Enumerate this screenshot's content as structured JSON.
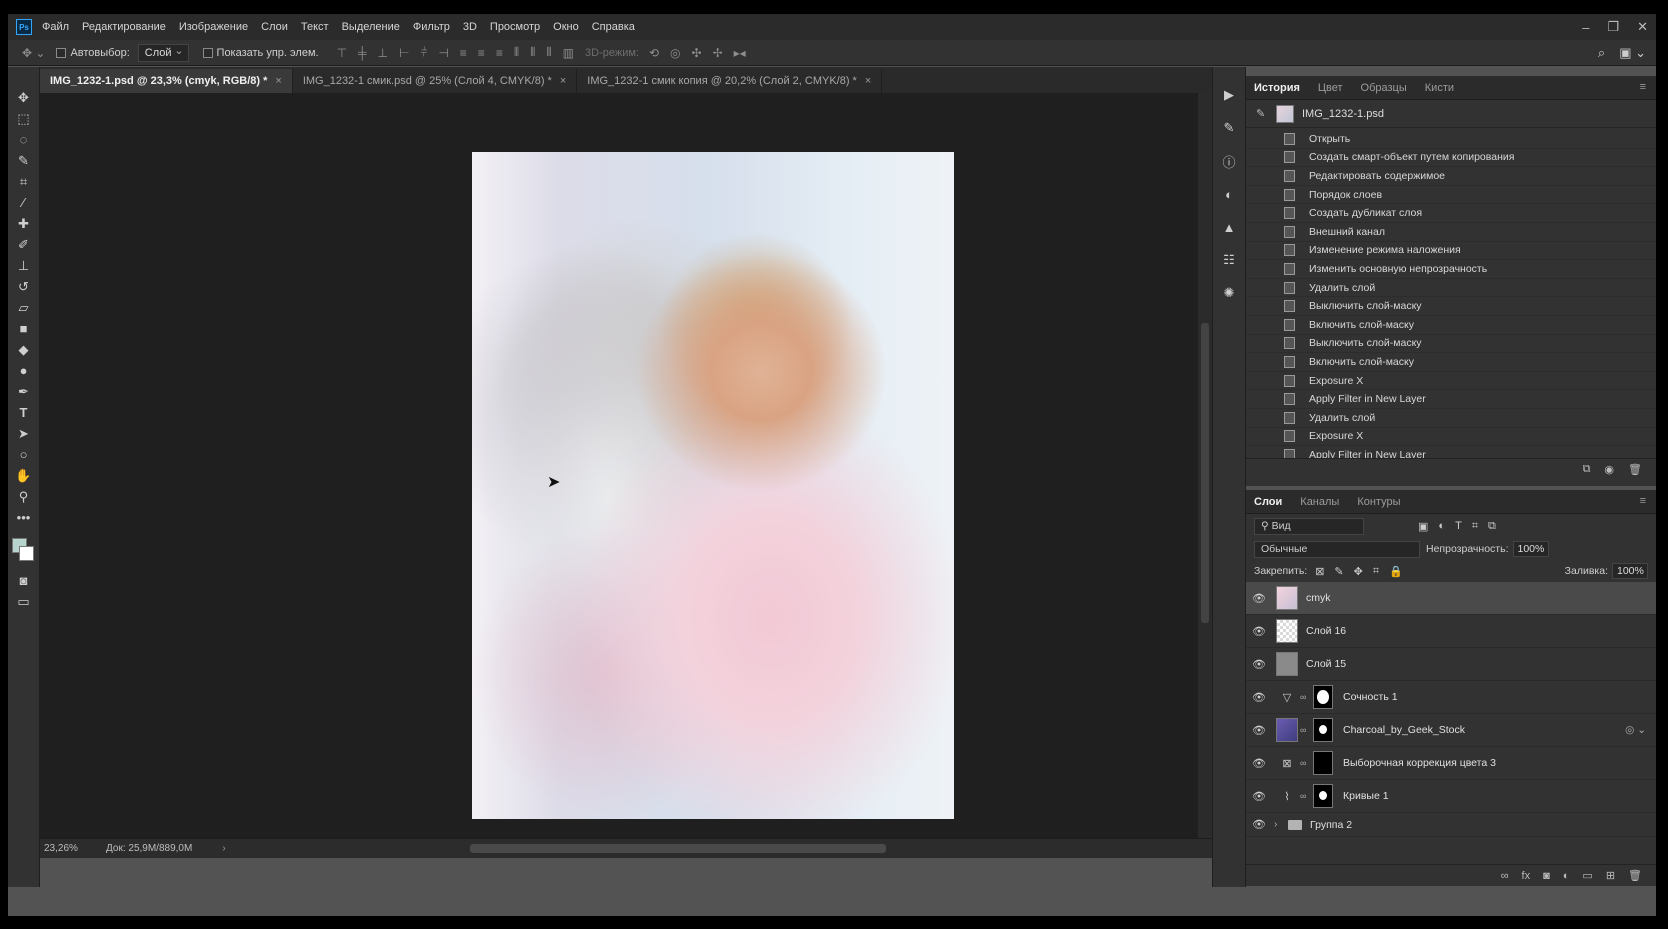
{
  "menu": [
    "Файл",
    "Редактирование",
    "Изображение",
    "Слои",
    "Текст",
    "Выделение",
    "Фильтр",
    "3D",
    "Просмотр",
    "Окно",
    "Справка"
  ],
  "options_bar": {
    "autoselect_label": "Автовыбор:",
    "autoselect_value": "Слой",
    "show_transform_label": "Показать упр. элем.",
    "mode3d_label": "3D-режим:"
  },
  "doc_tabs": [
    {
      "label": "IMG_1232-1.psd @ 23,3% (cmyk, RGB/8) *",
      "active": true
    },
    {
      "label": "IMG_1232-1 смик.psd @ 25% (Слой 4, CMYK/8) *",
      "active": false
    },
    {
      "label": "IMG_1232-1 смик копия @ 20,2% (Слой 2, CMYK/8) *",
      "active": false
    }
  ],
  "status": {
    "zoom": "23,26%",
    "doc": "Док: 25,9M/889,0M"
  },
  "history_panel": {
    "tabs": [
      "История",
      "Цвет",
      "Образцы",
      "Кисти"
    ],
    "snapshot": "IMG_1232-1.psd",
    "items": [
      "Открыть",
      "Создать смарт-объект путем копирования",
      "Редактировать содержимое",
      "Порядок слоев",
      "Создать дубликат слоя",
      "Внешний канал",
      "Изменение режима наложения",
      "Изменить основную непрозрачность",
      "Удалить слой",
      "Выключить слой-маску",
      "Включить слой-маску",
      "Выключить слой-маску",
      "Включить слой-маску",
      "Exposure X",
      "Apply Filter in New Layer",
      "Удалить слой",
      "Exposure X",
      "Apply Filter in New Layer"
    ]
  },
  "layers_panel": {
    "tabs": [
      "Слои",
      "Каналы",
      "Контуры"
    ],
    "filter_value": "Вид",
    "blend_mode": "Обычные",
    "opacity_label": "Непрозрачность:",
    "opacity_value": "100%",
    "lock_label": "Закрепить:",
    "fill_label": "Заливка:",
    "fill_value": "100%",
    "layers": [
      {
        "name": "cmyk",
        "kind": "photo",
        "selected": true
      },
      {
        "name": "Слой 16",
        "kind": "transparent"
      },
      {
        "name": "Слой 15",
        "kind": "gray"
      },
      {
        "name": "Сочность 1",
        "kind": "adjustment-vibrance"
      },
      {
        "name": "Charcoal_by_Geek_Stock",
        "kind": "smart"
      },
      {
        "name": "Выборочная коррекция цвета 3",
        "kind": "adjustment-selective"
      },
      {
        "name": "Кривые 1",
        "kind": "adjustment-curves"
      },
      {
        "name": "Группа 2",
        "kind": "group"
      }
    ]
  },
  "colors": {
    "foreground": "#b8d4cf",
    "background": "#ffffff",
    "accent": "#31a8ff"
  }
}
